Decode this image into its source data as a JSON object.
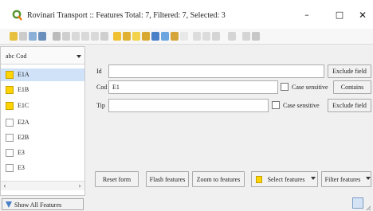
{
  "window": {
    "title": "Rovinari Transport :: Features Total: 7, Filtered: 7, Selected: 3"
  },
  "list": {
    "header": "abc Cod",
    "rows": [
      {
        "label": "E1A",
        "selected": true
      },
      {
        "label": "E1B",
        "selected": true
      },
      {
        "label": "E1C",
        "selected": true
      },
      {
        "label": "E2A",
        "selected": false
      },
      {
        "label": "E2B",
        "selected": false
      },
      {
        "label": "E3",
        "selected": false
      },
      {
        "label": "E3",
        "selected": false
      }
    ],
    "show_all": "Show All Features"
  },
  "form": {
    "id_label": "Id",
    "id_value": "",
    "cod_label": "Cod",
    "cod_value": "E1",
    "tip_label": "Tip",
    "tip_value": "",
    "case_sensitive": "Case sensitive",
    "exclude_field": "Exclude field",
    "contains": "Contains"
  },
  "buttons": {
    "reset": "Reset form",
    "flash": "Flash features",
    "zoom": "Zoom to features",
    "select": "Select features",
    "filter": "Filter features"
  },
  "colors": {
    "selected_row": "#cfe2f8",
    "yellow": "#ffd400",
    "qgis_green": "#589632"
  }
}
